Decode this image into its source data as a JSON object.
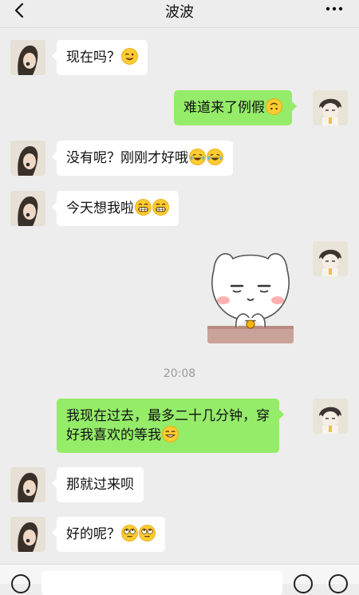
{
  "header": {
    "title": "波波",
    "back_icon": "chevron-left-icon",
    "more_icon": "more-dots-icon"
  },
  "messages": [
    {
      "side": "left",
      "text": "现在吗？",
      "emojis": [
        "wink"
      ]
    },
    {
      "side": "right",
      "text": "难道来了例假",
      "emojis": [
        "upside-down"
      ]
    },
    {
      "side": "left",
      "text": "没有呢？刚刚才好哦",
      "emojis": [
        "tears-of-joy",
        "tears-of-joy"
      ]
    },
    {
      "side": "left",
      "text": "今天想我啦",
      "emojis": [
        "grin",
        "grin"
      ]
    },
    {
      "side": "right",
      "sticker": "cat-sticker"
    },
    {
      "side": "right",
      "text_lines": [
        "我现在过去，最多二十几分钟，穿",
        "好我喜欢的等我"
      ],
      "emojis": [
        "smirk"
      ]
    },
    {
      "side": "left",
      "text": "那就过来呗",
      "emojis": []
    },
    {
      "side": "left",
      "text": "好的呢？",
      "emojis": [
        "rolling-eyes",
        "rolling-eyes"
      ]
    }
  ],
  "timestamp": "20:08",
  "input_bar": {
    "voice_icon": "voice-icon",
    "emoji_icon": "emoji-icon",
    "plus_icon": "plus-icon"
  },
  "colors": {
    "background": "#ededed",
    "sent_bubble": "#95ec69",
    "received_bubble": "#ffffff"
  }
}
